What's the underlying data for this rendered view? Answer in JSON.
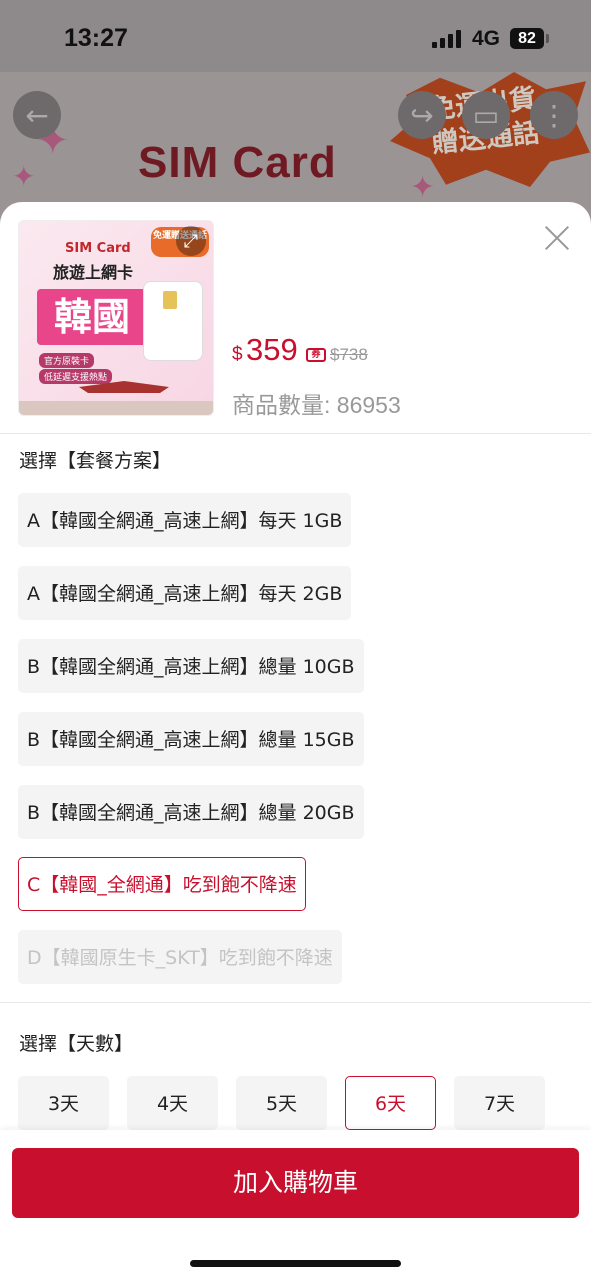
{
  "status_bar": {
    "time": "13:27",
    "network": "4G",
    "battery": "82"
  },
  "background": {
    "banner_title": "SIM Card",
    "banner_title2": "旅遊上網卡",
    "promo_line1": "免運出貨",
    "promo_line2": "贈送通話"
  },
  "product": {
    "thumb_sim": "SIM Card",
    "thumb_sub": "旅遊上網卡",
    "thumb_country": "韓國",
    "thumb_badge1": "官方原裝卡",
    "thumb_badge2": "低延遲支援熱點",
    "thumb_ribbon": "免運贈送通話",
    "currency": "$",
    "price": "359",
    "coupon_label": "券",
    "original_price": "$738",
    "quantity_label": "商品數量: 86953"
  },
  "plan_section": {
    "title": "選擇【套餐方案】",
    "options": [
      {
        "label": "A【韓國全網通_高速上網】每天 1GB",
        "state": "normal"
      },
      {
        "label": "A【韓國全網通_高速上網】每天 2GB",
        "state": "normal"
      },
      {
        "label": "B【韓國全網通_高速上網】總量 10GB",
        "state": "normal"
      },
      {
        "label": "B【韓國全網通_高速上網】總量 15GB",
        "state": "normal"
      },
      {
        "label": "B【韓國全網通_高速上網】總量 20GB",
        "state": "normal"
      },
      {
        "label": "C【韓國_全網通】吃到飽不降速",
        "state": "selected"
      },
      {
        "label": "D【韓國原生卡_SKT】吃到飽不降速",
        "state": "disabled"
      }
    ]
  },
  "days_section": {
    "title": "選擇【天數】",
    "options": [
      {
        "label": "3天",
        "state": "normal"
      },
      {
        "label": "4天",
        "state": "normal"
      },
      {
        "label": "5天",
        "state": "normal"
      },
      {
        "label": "6天",
        "state": "selected"
      },
      {
        "label": "7天",
        "state": "normal"
      }
    ]
  },
  "cart_button": "加入購物車",
  "colors": {
    "accent": "#c8102e",
    "option_bg": "#f4f4f4",
    "muted": "#999999"
  }
}
